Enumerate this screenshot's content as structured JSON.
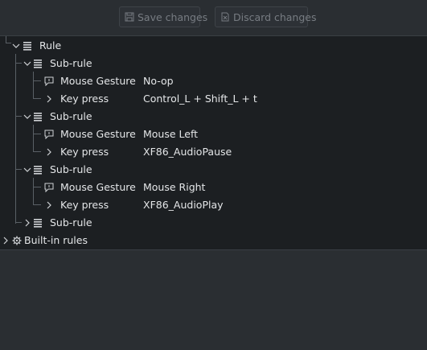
{
  "toolbar": {
    "save_label": "Save changes",
    "discard_label": "Discard changes"
  },
  "tree": {
    "rule_label": "Rule",
    "subrules": [
      {
        "label": "Sub-rule",
        "gesture_label": "Mouse Gesture",
        "gesture_value": "No-op",
        "key_label": "Key press",
        "key_value": "Control_L + Shift_L + t"
      },
      {
        "label": "Sub-rule",
        "gesture_label": "Mouse Gesture",
        "gesture_value": "Mouse Left",
        "key_label": "Key press",
        "key_value": "XF86_AudioPause"
      },
      {
        "label": "Sub-rule",
        "gesture_label": "Mouse Gesture",
        "gesture_value": "Mouse Right",
        "key_label": "Key press",
        "key_value": "XF86_AudioPlay"
      },
      {
        "label": "Sub-rule"
      }
    ],
    "builtin_label": "Built-in rules"
  },
  "colors": {
    "tree_bg": "#1c1f22",
    "panel_bg": "#2a2e32",
    "disabled_text": "#777c82",
    "text": "#e4e6e8"
  }
}
